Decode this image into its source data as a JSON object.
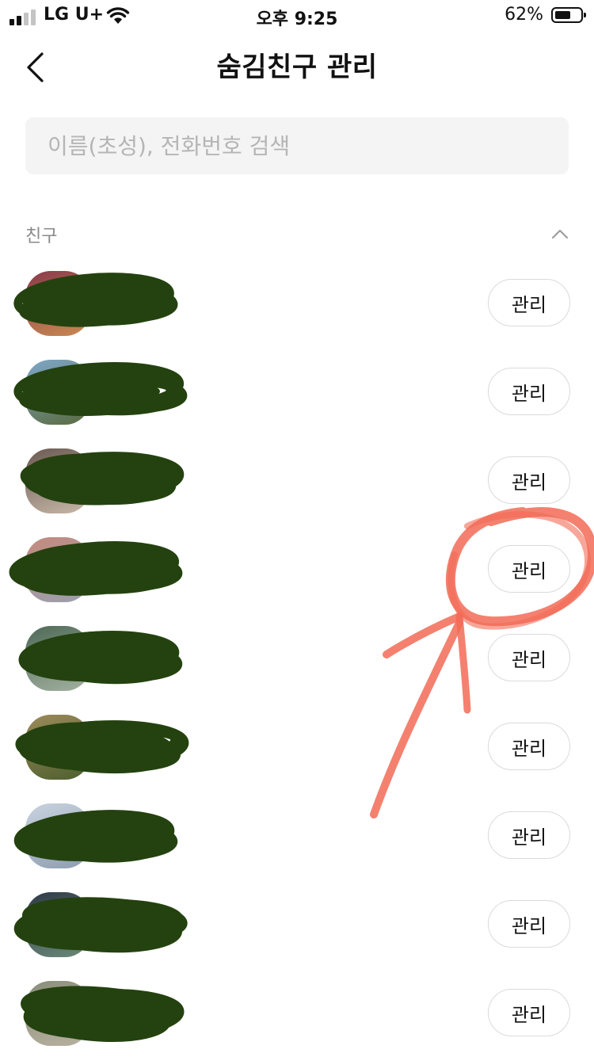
{
  "status_bar": {
    "carrier": "LG U+",
    "time": "오후 9:25",
    "battery_percent": "62%",
    "battery_level": 0.62,
    "signal_bars_active": 2
  },
  "header": {
    "title": "숨김친구 관리",
    "back_icon": "chevron-left-icon"
  },
  "search": {
    "placeholder": "이름(초성), 전화번호 검색",
    "value": ""
  },
  "section": {
    "label": "친구",
    "toggle_icon": "chevron-up-icon"
  },
  "friends": [
    {
      "name": "",
      "manage_label": "관리",
      "avatar_colors": [
        "#8a3b4a",
        "#c98a52"
      ]
    },
    {
      "name": "",
      "manage_label": "관리",
      "avatar_colors": [
        "#7fa7c9",
        "#5a6b3e"
      ]
    },
    {
      "name": "",
      "manage_label": "관리",
      "avatar_colors": [
        "#6b5a52",
        "#c7b8a8"
      ]
    },
    {
      "name": "",
      "manage_label": "관리",
      "avatar_colors": [
        "#c48a7d",
        "#9aa0b0"
      ]
    },
    {
      "name": "",
      "manage_label": "관리",
      "avatar_colors": [
        "#4f6a58",
        "#a3b1a0"
      ]
    },
    {
      "name": "",
      "manage_label": "관리",
      "avatar_colors": [
        "#9c8a5a",
        "#4d5f2e"
      ]
    },
    {
      "name": "",
      "manage_label": "관리",
      "avatar_colors": [
        "#c9d3e0",
        "#8e9db0"
      ]
    },
    {
      "name": "",
      "manage_label": "관리",
      "avatar_colors": [
        "#2f3a48",
        "#6b8a7a"
      ]
    },
    {
      "name": "",
      "manage_label": "관리",
      "avatar_colors": [
        "#8a8f7a",
        "#b8b0a0"
      ]
    }
  ],
  "colors": {
    "scribble": "#24420f",
    "annotation": "#f26b56",
    "search_bg": "#f4f4f5",
    "button_border": "#dadada"
  }
}
